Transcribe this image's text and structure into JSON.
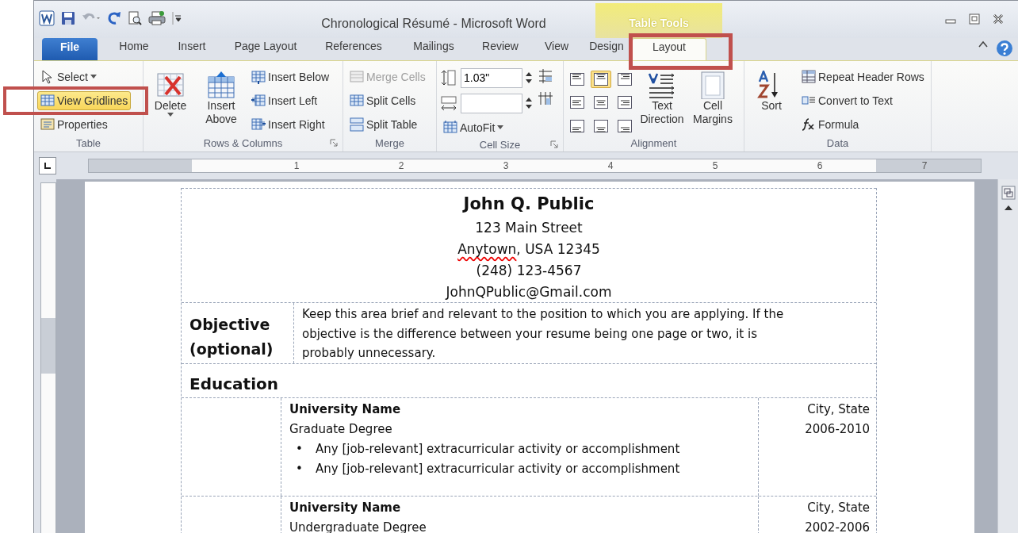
{
  "window": {
    "title": "Chronological Résumé - Microsoft Word",
    "context_group": "Table Tools"
  },
  "tabs": [
    {
      "label": "File",
      "kind": "file",
      "selected": false,
      "highlighted": false
    },
    {
      "label": "Home",
      "kind": "normal",
      "selected": false,
      "highlighted": false
    },
    {
      "label": "Insert",
      "kind": "normal",
      "selected": false,
      "highlighted": false
    },
    {
      "label": "Page Layout",
      "kind": "normal",
      "selected": false,
      "highlighted": false
    },
    {
      "label": "References",
      "kind": "normal",
      "selected": false,
      "highlighted": false
    },
    {
      "label": "Mailings",
      "kind": "normal",
      "selected": false,
      "highlighted": false
    },
    {
      "label": "Review",
      "kind": "normal",
      "selected": false,
      "highlighted": false
    },
    {
      "label": "View",
      "kind": "normal",
      "selected": false,
      "highlighted": false
    },
    {
      "label": "Design",
      "kind": "contextual",
      "selected": false,
      "highlighted": false
    },
    {
      "label": "Layout",
      "kind": "contextual",
      "selected": true,
      "highlighted": true
    }
  ],
  "ribbon": [
    {
      "label": "Table",
      "launcher": false,
      "columns": [
        [
          {
            "kind": "small",
            "label": "Select",
            "dropdown": true
          },
          {
            "kind": "small",
            "label": "View Gridlines",
            "selected": true,
            "highlighted": true
          },
          {
            "kind": "small",
            "label": "Properties"
          }
        ]
      ]
    },
    {
      "label": "Rows & Columns",
      "launcher": true,
      "columns": [
        [
          {
            "kind": "large",
            "label": "Delete",
            "dropdown": true
          }
        ],
        [
          {
            "kind": "large",
            "label": "Insert Above"
          }
        ],
        [
          {
            "kind": "small",
            "label": "Insert Below"
          },
          {
            "kind": "small",
            "label": "Insert Left"
          },
          {
            "kind": "small",
            "label": "Insert Right"
          }
        ]
      ]
    },
    {
      "label": "Merge",
      "launcher": false,
      "columns": [
        [
          {
            "kind": "small",
            "label": "Merge Cells",
            "disabled": true
          },
          {
            "kind": "small",
            "label": "Split Cells",
            "disabled": false
          },
          {
            "kind": "small",
            "label": "Split Table",
            "disabled": false
          }
        ]
      ]
    },
    {
      "label": "Cell Size",
      "launcher": true,
      "columns": [
        [
          {
            "kind": "spin",
            "value": "1.03\""
          },
          {
            "kind": "spin"
          },
          {
            "kind": "small",
            "label": "AutoFit",
            "dropdown": true
          }
        ],
        [
          {
            "kind": "icon"
          },
          {
            "kind": "icon"
          }
        ]
      ]
    },
    {
      "label": "Alignment",
      "launcher": false,
      "columns": [
        [
          {
            "kind": "align",
            "selected": false
          },
          {
            "kind": "align",
            "selected": true
          },
          {
            "kind": "align",
            "selected": false
          },
          {
            "kind": "align",
            "selected": false
          },
          {
            "kind": "align",
            "selected": false
          },
          {
            "kind": "align",
            "selected": false
          },
          {
            "kind": "align",
            "selected": false
          },
          {
            "kind": "align",
            "selected": false
          },
          {
            "kind": "align",
            "selected": false
          }
        ],
        [
          {
            "kind": "large",
            "label": "Text Direction"
          }
        ],
        [
          {
            "kind": "large",
            "label": "Cell Margins"
          }
        ]
      ]
    },
    {
      "label": "Data",
      "launcher": false,
      "columns": [
        [
          {
            "kind": "large",
            "label": "Sort"
          }
        ],
        [
          {
            "kind": "small",
            "label": "Repeat Header Rows"
          },
          {
            "kind": "small",
            "label": "Convert to Text"
          },
          {
            "kind": "small",
            "label": "Formula"
          }
        ]
      ]
    }
  ],
  "ruler": {
    "labels": [
      "1",
      "2",
      "3",
      "4",
      "5",
      "6",
      "7"
    ]
  },
  "document": {
    "name": "John Q. Public",
    "address_lines": [
      [
        {
          "text": "123 Main Street",
          "misspelled": false
        }
      ],
      [
        {
          "text": "Anytown",
          "misspelled": true
        },
        {
          "text": ", USA 12345",
          "misspelled": false
        }
      ],
      [
        {
          "text": "(248) 123-4567",
          "misspelled": false
        }
      ],
      [
        {
          "text": "JohnQPublic@Gmail.com",
          "misspelled": false
        }
      ]
    ],
    "objective": {
      "heading": [
        "Objective",
        "(optional)"
      ],
      "text": "Keep this area brief and relevant to the position to which you are applying. If the objective is the difference between your resume being one page or two, it is probably unnecessary."
    },
    "education": {
      "heading": "Education",
      "entries": [
        {
          "school": "University Name",
          "degree": "Graduate Degree",
          "location": "City, State",
          "years": "2006-2010",
          "bullets": [
            {
              "marker": "•",
              "text": "Any [job-relevant] extracurricular  activity or accomplishment"
            },
            {
              "marker": "•",
              "text": "Any [job-relevant] extracurricular  activity or accomplishment"
            }
          ]
        },
        {
          "school": "University Name",
          "degree": "Undergraduate Degree",
          "location": "City, State",
          "years": "2002-2006"
        }
      ]
    }
  }
}
